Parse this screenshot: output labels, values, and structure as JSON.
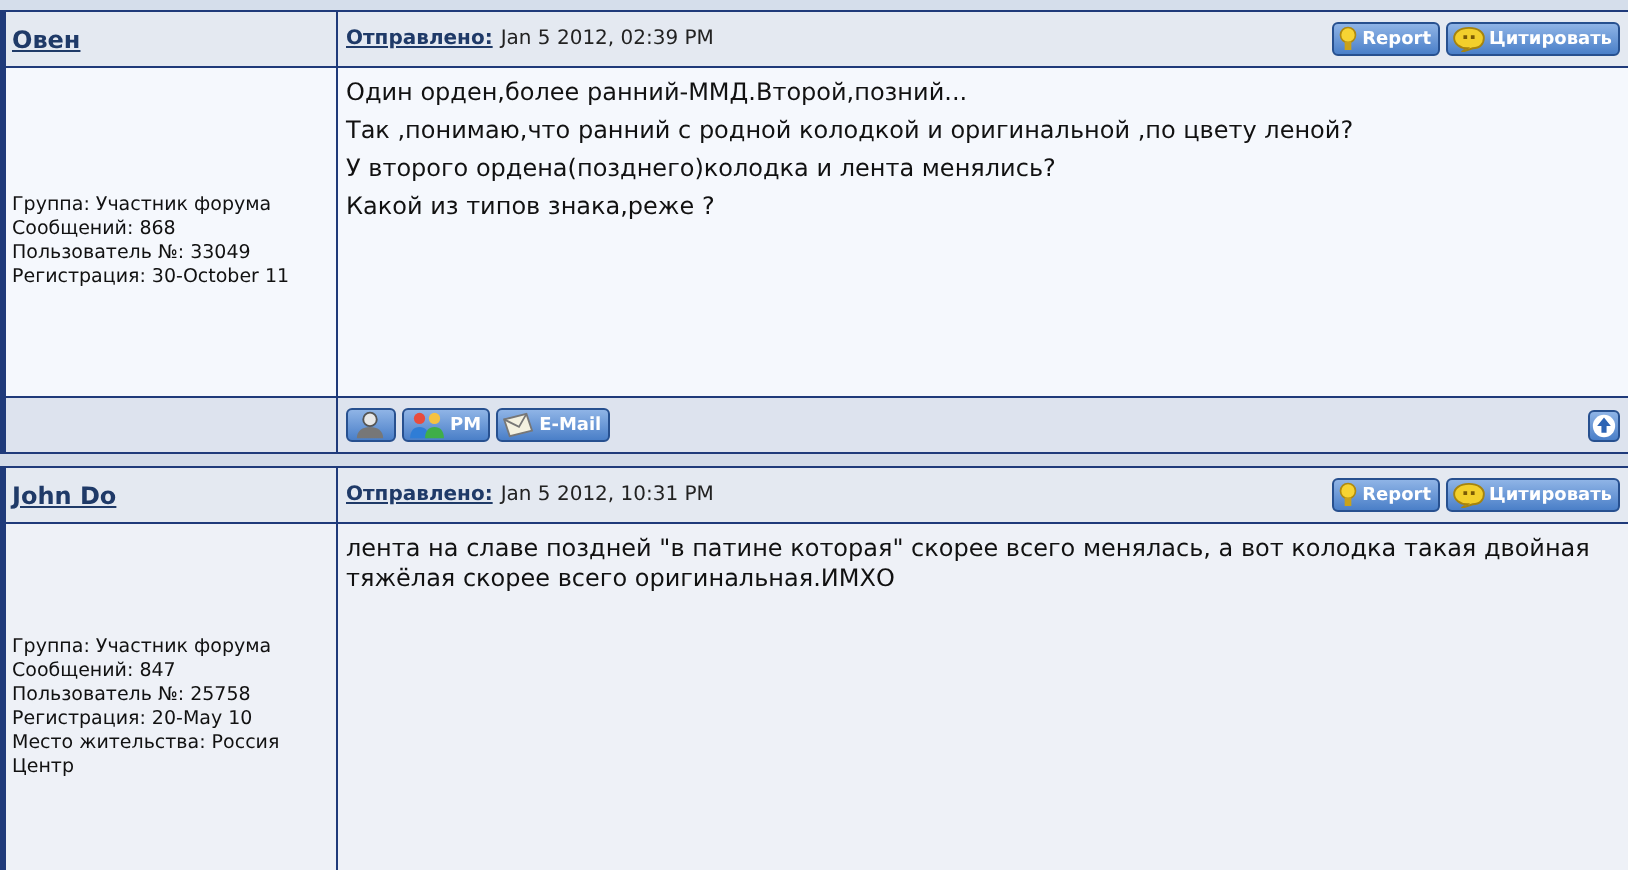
{
  "posts": [
    {
      "author": "Овен",
      "posted_label": "Отправлено:",
      "posted_date": "Jan 5 2012, 02:39 PM",
      "actions": [
        {
          "kind": "report",
          "label": "Report"
        },
        {
          "kind": "quote",
          "label": "Цитировать"
        }
      ],
      "details": [
        "Группа: Участник форума",
        "Сообщений: 868",
        "Пользователь №: 33049",
        "Регистрация: 30-October 11"
      ],
      "message": [
        "Один орден,более ранний-ММД.Второй,позний...",
        "Так ,понимаю,что ранний с родной колодкой и оригинальной ,по цвету леной?",
        "У второго ордена(позднего)колодка и лента менялись?",
        "Какой из типов знака,реже ?"
      ],
      "footer_buttons": [
        {
          "kind": "profile"
        },
        {
          "kind": "pm",
          "label": "PM"
        },
        {
          "kind": "email",
          "label": "E-Mail"
        }
      ],
      "top_button": {
        "kind": "top"
      }
    },
    {
      "author": "John Do",
      "posted_label": "Отправлено:",
      "posted_date": "Jan 5 2012, 10:31 PM",
      "actions": [
        {
          "kind": "report",
          "label": "Report"
        },
        {
          "kind": "quote",
          "label": "Цитировать"
        }
      ],
      "details": [
        "Группа: Участник форума",
        "Сообщений: 847",
        "Пользователь №: 25758",
        "Регистрация: 20-May 10",
        "Место жительства: Россия",
        "Центр"
      ],
      "message": [
        "лента на славе поздней \"в патине которая\" скорее всего менялась, а вот колодка такая двойная тяжёлая скорее всего оригинальная.ИМХО"
      ]
    }
  ]
}
